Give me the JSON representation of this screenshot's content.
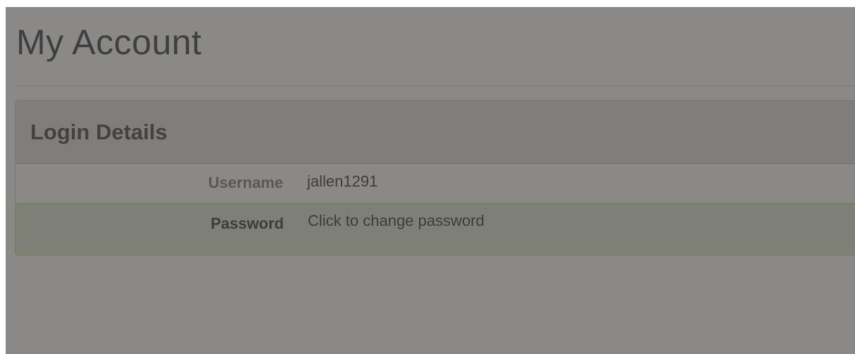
{
  "page": {
    "title": "My Account"
  },
  "login_details": {
    "heading": "Login Details",
    "username": {
      "label": "Username",
      "value": "jallen1291"
    },
    "password": {
      "label": "Password",
      "value": "Click to change password"
    }
  },
  "colors": {
    "overlay_background": "#8a8987",
    "panel_header": "#7f7e7c",
    "password_row_highlight": "#7e7f77",
    "password_row_border": "#6b8a44",
    "text_dark": "#3e3d3c"
  }
}
